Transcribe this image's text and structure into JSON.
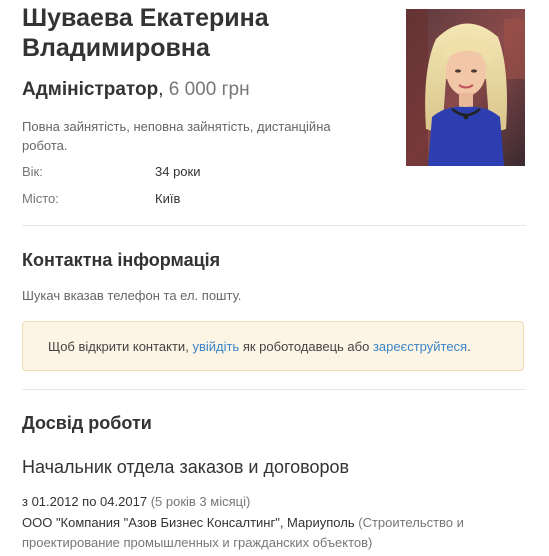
{
  "profile": {
    "name": "Шуваева Екатерина Владимировна",
    "position": "Адміністратор",
    "separator": ",",
    "salary": "6 000 грн",
    "employment": "Повна зайнятість, неповна зайнятість, дистанційна робота.",
    "age_label": "Вік:",
    "age_value": "34 роки",
    "city_label": "Місто:",
    "city_value": "Київ"
  },
  "contacts": {
    "title": "Контактна інформація",
    "note": "Шукач вказав телефон та ел. пошту.",
    "notice_prefix": "Щоб відкрити контакти,",
    "login_link": "увійдіть",
    "notice_middle": "як роботодавець або",
    "register_link": "зареєструйтеся",
    "notice_suffix": "."
  },
  "experience": {
    "title": "Досвід роботи",
    "job": {
      "title": "Начальник отдела заказов и договоров",
      "period": "з 01.2012 по 04.2017",
      "duration": "(5 років 3 місяці)",
      "company": "ООО \"Компания \"Азов Бизнес Консалтинг\", Мариуполь",
      "industry": "(Строительство и проектирование промышленных и гражданских объектов)"
    }
  },
  "colors": {
    "link": "#3a86c8",
    "notice_bg": "#fcf4e4",
    "notice_border": "#f1ddb3"
  }
}
